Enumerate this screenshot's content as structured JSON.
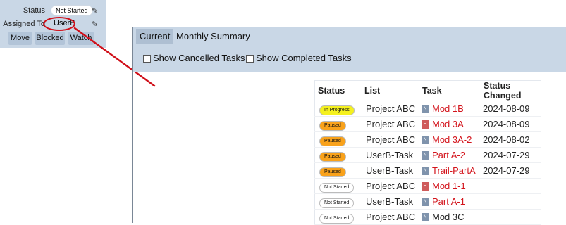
{
  "mini_panel": {
    "status_label": "Status",
    "status_value": "Not Started",
    "assigned_label": "Assigned To",
    "assigned_value": "UserB",
    "buttons": [
      "Move",
      "Blocked",
      "Watch"
    ],
    "annotation_color": "#d0101a"
  },
  "report": {
    "tabs": [
      {
        "label": "Current",
        "active": true
      },
      {
        "label": "Monthly Summary",
        "active": false
      }
    ],
    "filters": [
      {
        "label": "Show Cancelled Tasks",
        "checked": false
      },
      {
        "label": "Show Completed Tasks",
        "checked": false
      }
    ],
    "table": {
      "headers": [
        "Status",
        "List",
        "Task",
        "Status Changed"
      ],
      "rows": [
        {
          "status": "In Progress",
          "status_color": "#f5f11e",
          "list": "Project ABC",
          "priority": "N",
          "priority_color": "#7f93ac",
          "task": "Mod 1B",
          "task_color": "#d3141c",
          "changed": "2024-08-09"
        },
        {
          "status": "Paused",
          "status_color": "#f9a21b",
          "list": "Project ABC",
          "priority": "H",
          "priority_color": "#cf5b5b",
          "task": "Mod 3A",
          "task_color": "#d3141c",
          "changed": "2024-08-09"
        },
        {
          "status": "Paused",
          "status_color": "#f9a21b",
          "list": "Project ABC",
          "priority": "N",
          "priority_color": "#7f93ac",
          "task": "Mod 3A-2",
          "task_color": "#d3141c",
          "changed": "2024-08-02"
        },
        {
          "status": "Paused",
          "status_color": "#f9a21b",
          "list": "UserB-Task",
          "priority": "N",
          "priority_color": "#7f93ac",
          "task": "Part A-2",
          "task_color": "#d3141c",
          "changed": "2024-07-29"
        },
        {
          "status": "Paused",
          "status_color": "#f9a21b",
          "list": "UserB-Task",
          "priority": "N",
          "priority_color": "#7f93ac",
          "task": "Trail-PartA",
          "task_color": "#d3141c",
          "changed": "2024-07-29"
        },
        {
          "status": "Not Started",
          "status_color": "#ffffff",
          "list": "Project ABC",
          "priority": "H",
          "priority_color": "#cf5b5b",
          "task": "Mod 1-1",
          "task_color": "#d3141c",
          "changed": ""
        },
        {
          "status": "Not Started",
          "status_color": "#ffffff",
          "list": "UserB-Task",
          "priority": "N",
          "priority_color": "#7f93ac",
          "task": "Part A-1",
          "task_color": "#d3141c",
          "changed": ""
        },
        {
          "status": "Not Started",
          "status_color": "#ffffff",
          "list": "Project ABC",
          "priority": "N",
          "priority_color": "#7f93ac",
          "task": "Mod 3C",
          "task_color": "#222222",
          "changed": ""
        }
      ]
    }
  }
}
